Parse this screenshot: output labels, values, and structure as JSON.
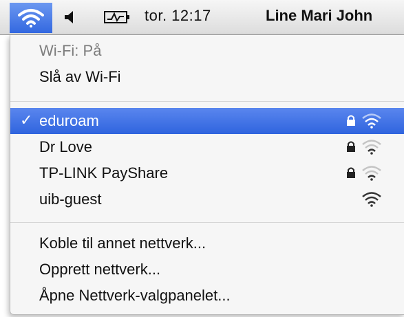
{
  "menubar": {
    "clock": "tor. 12:17",
    "user": "Line Mari John"
  },
  "menu": {
    "status": "Wi-Fi: På",
    "toggle": "Slå av Wi-Fi",
    "networks": [
      {
        "name": "eduroam",
        "locked": true,
        "selected": true
      },
      {
        "name": "Dr Love",
        "locked": true,
        "selected": false
      },
      {
        "name": "TP-LINK PayShare",
        "locked": true,
        "selected": false
      },
      {
        "name": "uib-guest",
        "locked": false,
        "selected": false
      }
    ],
    "check_mark": "✓",
    "actions": [
      "Koble til annet nettverk...",
      "Opprett nettverk...",
      "Åpne Nettverk-valgpanelet..."
    ]
  },
  "colors": {
    "selection": "#3368e0",
    "menubar": "#e6e6e6"
  }
}
